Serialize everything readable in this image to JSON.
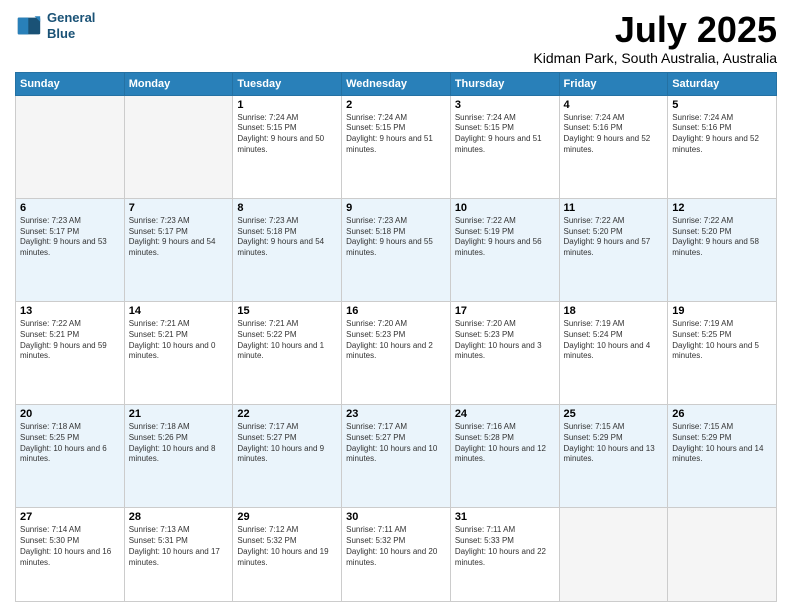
{
  "header": {
    "logo_line1": "General",
    "logo_line2": "Blue",
    "month": "July 2025",
    "location": "Kidman Park, South Australia, Australia"
  },
  "weekdays": [
    "Sunday",
    "Monday",
    "Tuesday",
    "Wednesday",
    "Thursday",
    "Friday",
    "Saturday"
  ],
  "rows": [
    {
      "cells": [
        {
          "empty": true
        },
        {
          "empty": true
        },
        {
          "day": "1",
          "sunrise": "Sunrise: 7:24 AM",
          "sunset": "Sunset: 5:15 PM",
          "daylight": "Daylight: 9 hours and 50 minutes."
        },
        {
          "day": "2",
          "sunrise": "Sunrise: 7:24 AM",
          "sunset": "Sunset: 5:15 PM",
          "daylight": "Daylight: 9 hours and 51 minutes."
        },
        {
          "day": "3",
          "sunrise": "Sunrise: 7:24 AM",
          "sunset": "Sunset: 5:15 PM",
          "daylight": "Daylight: 9 hours and 51 minutes."
        },
        {
          "day": "4",
          "sunrise": "Sunrise: 7:24 AM",
          "sunset": "Sunset: 5:16 PM",
          "daylight": "Daylight: 9 hours and 52 minutes."
        },
        {
          "day": "5",
          "sunrise": "Sunrise: 7:24 AM",
          "sunset": "Sunset: 5:16 PM",
          "daylight": "Daylight: 9 hours and 52 minutes."
        }
      ]
    },
    {
      "cells": [
        {
          "day": "6",
          "sunrise": "Sunrise: 7:23 AM",
          "sunset": "Sunset: 5:17 PM",
          "daylight": "Daylight: 9 hours and 53 minutes."
        },
        {
          "day": "7",
          "sunrise": "Sunrise: 7:23 AM",
          "sunset": "Sunset: 5:17 PM",
          "daylight": "Daylight: 9 hours and 54 minutes."
        },
        {
          "day": "8",
          "sunrise": "Sunrise: 7:23 AM",
          "sunset": "Sunset: 5:18 PM",
          "daylight": "Daylight: 9 hours and 54 minutes."
        },
        {
          "day": "9",
          "sunrise": "Sunrise: 7:23 AM",
          "sunset": "Sunset: 5:18 PM",
          "daylight": "Daylight: 9 hours and 55 minutes."
        },
        {
          "day": "10",
          "sunrise": "Sunrise: 7:22 AM",
          "sunset": "Sunset: 5:19 PM",
          "daylight": "Daylight: 9 hours and 56 minutes."
        },
        {
          "day": "11",
          "sunrise": "Sunrise: 7:22 AM",
          "sunset": "Sunset: 5:20 PM",
          "daylight": "Daylight: 9 hours and 57 minutes."
        },
        {
          "day": "12",
          "sunrise": "Sunrise: 7:22 AM",
          "sunset": "Sunset: 5:20 PM",
          "daylight": "Daylight: 9 hours and 58 minutes."
        }
      ]
    },
    {
      "cells": [
        {
          "day": "13",
          "sunrise": "Sunrise: 7:22 AM",
          "sunset": "Sunset: 5:21 PM",
          "daylight": "Daylight: 9 hours and 59 minutes."
        },
        {
          "day": "14",
          "sunrise": "Sunrise: 7:21 AM",
          "sunset": "Sunset: 5:21 PM",
          "daylight": "Daylight: 10 hours and 0 minutes."
        },
        {
          "day": "15",
          "sunrise": "Sunrise: 7:21 AM",
          "sunset": "Sunset: 5:22 PM",
          "daylight": "Daylight: 10 hours and 1 minute."
        },
        {
          "day": "16",
          "sunrise": "Sunrise: 7:20 AM",
          "sunset": "Sunset: 5:23 PM",
          "daylight": "Daylight: 10 hours and 2 minutes."
        },
        {
          "day": "17",
          "sunrise": "Sunrise: 7:20 AM",
          "sunset": "Sunset: 5:23 PM",
          "daylight": "Daylight: 10 hours and 3 minutes."
        },
        {
          "day": "18",
          "sunrise": "Sunrise: 7:19 AM",
          "sunset": "Sunset: 5:24 PM",
          "daylight": "Daylight: 10 hours and 4 minutes."
        },
        {
          "day": "19",
          "sunrise": "Sunrise: 7:19 AM",
          "sunset": "Sunset: 5:25 PM",
          "daylight": "Daylight: 10 hours and 5 minutes."
        }
      ]
    },
    {
      "cells": [
        {
          "day": "20",
          "sunrise": "Sunrise: 7:18 AM",
          "sunset": "Sunset: 5:25 PM",
          "daylight": "Daylight: 10 hours and 6 minutes."
        },
        {
          "day": "21",
          "sunrise": "Sunrise: 7:18 AM",
          "sunset": "Sunset: 5:26 PM",
          "daylight": "Daylight: 10 hours and 8 minutes."
        },
        {
          "day": "22",
          "sunrise": "Sunrise: 7:17 AM",
          "sunset": "Sunset: 5:27 PM",
          "daylight": "Daylight: 10 hours and 9 minutes."
        },
        {
          "day": "23",
          "sunrise": "Sunrise: 7:17 AM",
          "sunset": "Sunset: 5:27 PM",
          "daylight": "Daylight: 10 hours and 10 minutes."
        },
        {
          "day": "24",
          "sunrise": "Sunrise: 7:16 AM",
          "sunset": "Sunset: 5:28 PM",
          "daylight": "Daylight: 10 hours and 12 minutes."
        },
        {
          "day": "25",
          "sunrise": "Sunrise: 7:15 AM",
          "sunset": "Sunset: 5:29 PM",
          "daylight": "Daylight: 10 hours and 13 minutes."
        },
        {
          "day": "26",
          "sunrise": "Sunrise: 7:15 AM",
          "sunset": "Sunset: 5:29 PM",
          "daylight": "Daylight: 10 hours and 14 minutes."
        }
      ]
    },
    {
      "cells": [
        {
          "day": "27",
          "sunrise": "Sunrise: 7:14 AM",
          "sunset": "Sunset: 5:30 PM",
          "daylight": "Daylight: 10 hours and 16 minutes."
        },
        {
          "day": "28",
          "sunrise": "Sunrise: 7:13 AM",
          "sunset": "Sunset: 5:31 PM",
          "daylight": "Daylight: 10 hours and 17 minutes."
        },
        {
          "day": "29",
          "sunrise": "Sunrise: 7:12 AM",
          "sunset": "Sunset: 5:32 PM",
          "daylight": "Daylight: 10 hours and 19 minutes."
        },
        {
          "day": "30",
          "sunrise": "Sunrise: 7:11 AM",
          "sunset": "Sunset: 5:32 PM",
          "daylight": "Daylight: 10 hours and 20 minutes."
        },
        {
          "day": "31",
          "sunrise": "Sunrise: 7:11 AM",
          "sunset": "Sunset: 5:33 PM",
          "daylight": "Daylight: 10 hours and 22 minutes."
        },
        {
          "empty": true
        },
        {
          "empty": true
        }
      ]
    }
  ]
}
